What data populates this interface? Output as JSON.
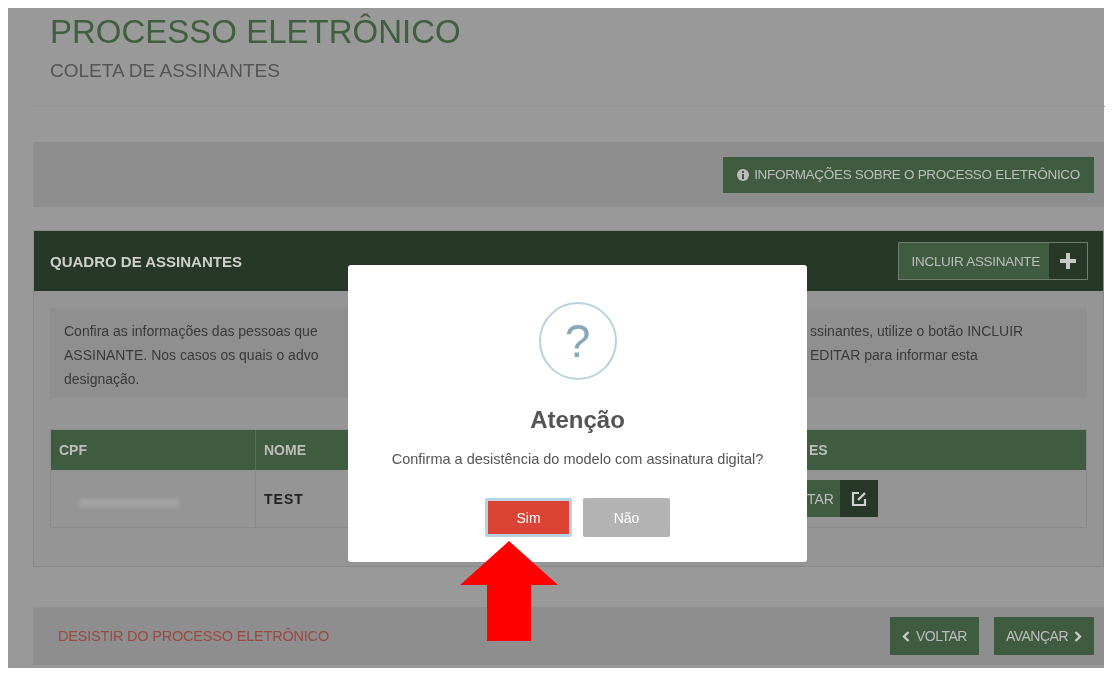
{
  "page": {
    "title": "PROCESSO ELETRÔNICO",
    "subtitle": "COLETA DE ASSINANTES"
  },
  "info_button": {
    "label": "INFORMAÇÕES SOBRE O PROCESSO ELETRÔNICO"
  },
  "panel": {
    "title": "QUADRO DE ASSINANTES",
    "add_button": {
      "label": "INCLUIR ASSINANTE"
    },
    "notice": {
      "left_lines": [
        "Confira as informações das pessoas que",
        "ASSINANTE. Nos casos os quais o advo",
        "designação."
      ],
      "right_lines": [
        "ssinantes, utilize o botão INCLUIR",
        "EDITAR para informar esta"
      ]
    },
    "table": {
      "columns": [
        "CPF",
        "NOME",
        "ES"
      ],
      "rows": [
        {
          "cpf_redacted": true,
          "nome": "TEST",
          "action": "TAR"
        }
      ]
    }
  },
  "footer": {
    "cancel_link": "DESISTIR DO PROCESSO ELETRÔNICO",
    "back_button": "VOLTAR",
    "next_button": "AVANÇAR"
  },
  "dialog": {
    "icon": "?",
    "title": "Atenção",
    "message": "Confirma a desistência do modelo com assinatura digital?",
    "buttons": [
      {
        "label": "Sim",
        "kind": "confirm",
        "focused": true
      },
      {
        "label": "Não",
        "kind": "cancel",
        "focused": false
      }
    ]
  }
}
